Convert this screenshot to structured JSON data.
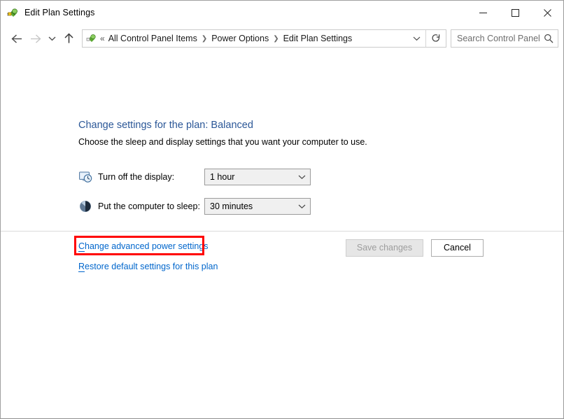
{
  "window": {
    "title": "Edit Plan Settings",
    "icon": "power-plug-icon",
    "controls": {
      "minimize": "minimize-icon",
      "maximize": "maximize-icon",
      "close": "close-icon"
    }
  },
  "navbar": {
    "back": "back-arrow-icon",
    "forward": "forward-arrow-icon",
    "recent": "chevron-down-icon",
    "up": "up-arrow-icon",
    "address": {
      "icon": "power-options-icon",
      "overflow": "«",
      "crumbs": [
        "All Control Panel Items",
        "Power Options",
        "Edit Plan Settings"
      ],
      "separator": "❯",
      "dropdown": "chevron-down-icon"
    },
    "refresh": "refresh-icon",
    "search": {
      "placeholder": "Search Control Panel",
      "value": "",
      "icon": "search-icon"
    }
  },
  "main": {
    "title": "Change settings for the plan: Balanced",
    "subtitle": "Choose the sleep and display settings that you want your computer to use.",
    "settings": [
      {
        "icon": "display-clock-icon",
        "label": "Turn off the display:",
        "value": "1 hour"
      },
      {
        "icon": "sleep-moon-icon",
        "label": "Put the computer to sleep:",
        "value": "30 minutes"
      }
    ],
    "links": [
      {
        "mnemonic": "C",
        "rest": "hange advanced power settings",
        "highlighted": true
      },
      {
        "mnemonic": "R",
        "rest": "estore default settings for this plan",
        "highlighted": false
      }
    ],
    "buttons": {
      "save": "Save changes",
      "cancel": "Cancel"
    }
  },
  "colors": {
    "heading": "#2b5797",
    "link": "#0066cc",
    "highlight": "#ff0000",
    "combo_background": "#f0f0f0"
  }
}
